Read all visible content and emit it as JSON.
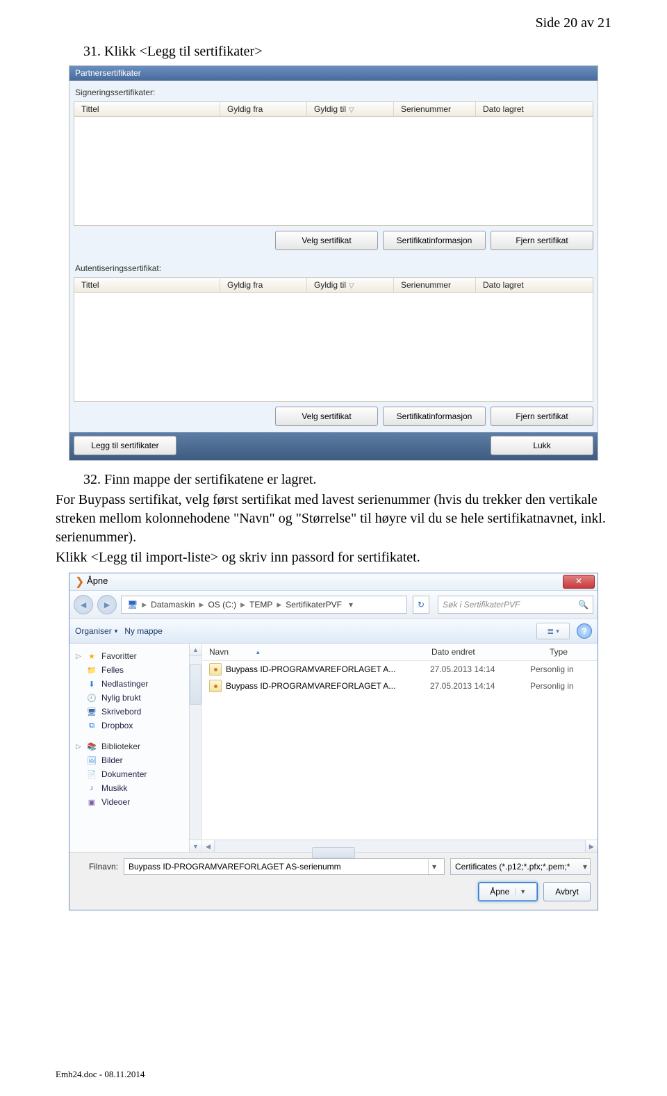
{
  "page": {
    "number_label": "Side 20 av 21",
    "footer": "Emh24.doc - 08.11.2014"
  },
  "steps": {
    "s31": "31.    Klikk <Legg til sertifikater>",
    "s32_title": "32.    Finn mappe der sertifikatene er lagret.",
    "s32_line1": "For Buypass sertifikat, velg først sertifikat med lavest serienummer (hvis du trekker den vertikale streken mellom kolonnehodene \"Navn\" og \"Størrelse\" til høyre vil du se hele sertifikatnavnet, inkl. serienummer).",
    "s32_line2": "Klikk <Legg til import-liste> og skriv inn passord for sertifikatet."
  },
  "cert": {
    "window_title": "Partnersertifikater",
    "sign_label": "Signeringssertifikater:",
    "auth_label": "Autentiseringssertifikat:",
    "cols": {
      "tittel": "Tittel",
      "gyldig_fra": "Gyldig fra",
      "gyldig_til": "Gyldig til",
      "serienummer": "Serienummer",
      "dato_lagret": "Dato lagret"
    },
    "btn_select": "Velg sertifikat",
    "btn_info": "Sertifikatinformasjon",
    "btn_remove": "Fjern sertifikat",
    "btn_add": "Legg til sertifikater",
    "btn_close": "Lukk"
  },
  "open": {
    "title": "Åpne",
    "crumbs": [
      "Datamaskin",
      "OS (C:)",
      "TEMP",
      "SertifikaterPVF"
    ],
    "search_placeholder": "Søk i SertifikaterPVF",
    "toolbar": {
      "organiser": "Organiser",
      "ny_mappe": "Ny mappe"
    },
    "nav": {
      "favoritter": "Favoritter",
      "felles": "Felles",
      "nedlastinger": "Nedlastinger",
      "nylig_brukt": "Nylig brukt",
      "skrivebord": "Skrivebord",
      "dropbox": "Dropbox",
      "biblioteker": "Biblioteker",
      "bilder": "Bilder",
      "dokumenter": "Dokumenter",
      "musikk": "Musikk",
      "videoer": "Videoer"
    },
    "columns": {
      "navn": "Navn",
      "dato": "Dato endret",
      "type": "Type"
    },
    "rows": [
      {
        "name": "Buypass ID-PROGRAMVAREFORLAGET A...",
        "date": "27.05.2013 14:14",
        "type": "Personlig in"
      },
      {
        "name": "Buypass ID-PROGRAMVAREFORLAGET A...",
        "date": "27.05.2013 14:14",
        "type": "Personlig in"
      }
    ],
    "filename_label": "Filnavn:",
    "filename_value": "Buypass ID-PROGRAMVAREFORLAGET AS-serienumm",
    "filter": "Certificates (*.p12;*.pfx;*.pem;*",
    "btn_open": "Åpne",
    "btn_cancel": "Avbryt"
  }
}
